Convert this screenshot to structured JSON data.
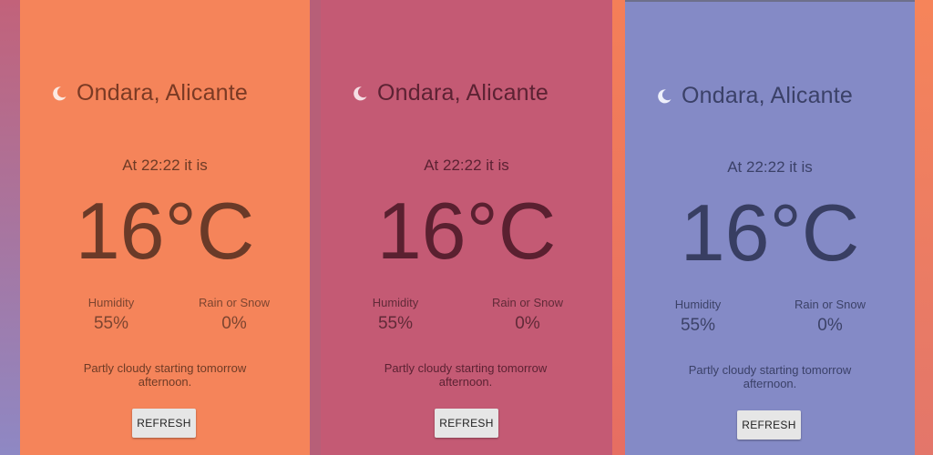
{
  "cards": [
    {
      "city": "Ondara, Alicante",
      "time_text": "At 22:22 it is",
      "temperature": "16°C",
      "humidity_label": "Humidity",
      "humidity_value": "55%",
      "rain_label": "Rain or Snow",
      "rain_value": "0%",
      "summary": "Partly cloudy starting tomorrow afternoon.",
      "refresh_label": "REFRESH",
      "icon": "moon-icon",
      "background": "#f5845a"
    },
    {
      "city": "Ondara, Alicante",
      "time_text": "At 22:22 it is",
      "temperature": "16°C",
      "humidity_label": "Humidity",
      "humidity_value": "55%",
      "rain_label": "Rain or Snow",
      "rain_value": "0%",
      "summary": "Partly cloudy starting tomorrow afternoon.",
      "refresh_label": "REFRESH",
      "icon": "moon-icon",
      "background": "#c45a74"
    },
    {
      "city": "Ondara, Alicante",
      "time_text": "At 22:22 it is",
      "temperature": "16°C",
      "humidity_label": "Humidity",
      "humidity_value": "55%",
      "rain_label": "Rain or Snow",
      "rain_value": "0%",
      "summary": "Partly cloudy starting tomorrow afternoon.",
      "refresh_label": "REFRESH",
      "icon": "moon-icon",
      "background": "#848ac6"
    }
  ]
}
